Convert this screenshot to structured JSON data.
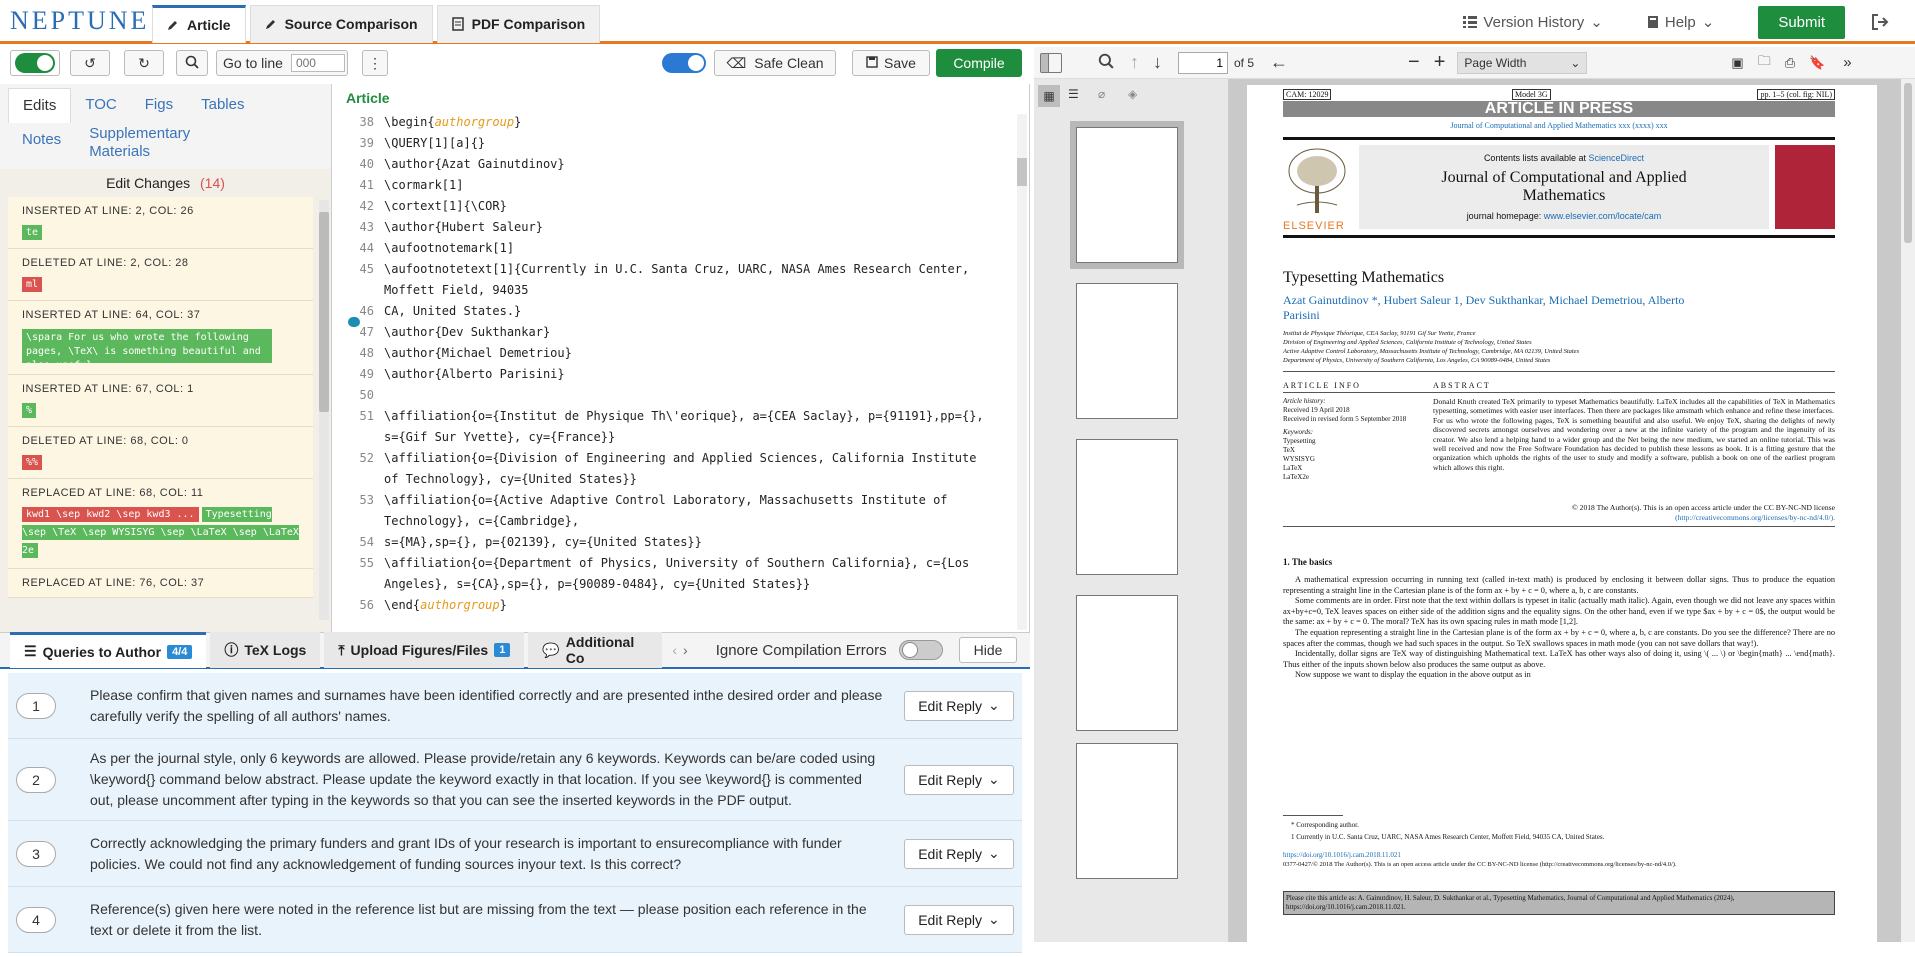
{
  "app": {
    "logo": "NEPTUNE",
    "tabs": [
      "Article",
      "Source Comparison",
      "PDF Comparison"
    ],
    "version_history": "Version History",
    "help": "Help",
    "submit": "Submit"
  },
  "toolbar": {
    "go_to_line": "Go to line",
    "line_placeholder": "000",
    "safe_clean": "Safe Clean",
    "save": "Save",
    "compile": "Compile"
  },
  "left": {
    "tabs": [
      "Edits",
      "TOC",
      "Figs",
      "Tables",
      "Notes",
      "Supplementary Materials"
    ],
    "edit_changes": "Edit Changes",
    "count": "(14)",
    "changes": [
      {
        "label": "INSERTED   AT LINE: 2, COL: 26",
        "type": "ins",
        "text": "te"
      },
      {
        "label": "DELETED   AT LINE: 2, COL: 28",
        "type": "del",
        "text": "ml"
      },
      {
        "label": "INSERTED   AT LINE: 64, COL: 37",
        "type": "ins",
        "text": "\\spara For us who wrote the following pages, \\TeX\\ is something beautiful and also useful."
      },
      {
        "label": "INSERTED   AT LINE: 67, COL: 1",
        "type": "ins",
        "text": "%"
      },
      {
        "label": "DELETED   AT LINE: 68, COL: 0",
        "type": "del",
        "text": "%%"
      },
      {
        "label": "REPLACED   AT LINE: 68, COL: 11",
        "type": "rep",
        "old": "kwd1 \\sep kwd2 \\sep kwd3 ...",
        "text": "Typesetting \\sep \\TeX \\sep WYSISYG \\sep \\LaTeX \\sep \\LaTeX 2e"
      },
      {
        "label": "REPLACED   AT LINE: 76, COL: 37",
        "type": "none",
        "text": ""
      }
    ]
  },
  "editor": {
    "title": "Article",
    "lines": [
      {
        "n": "38",
        "pre": "\\begin{",
        "kw": "authorgroup",
        "post": "}"
      },
      {
        "n": "39",
        "pre": "\\QUERY[1][a]{}"
      },
      {
        "n": "40",
        "pre": "\\author{Azat Gainutdinov}"
      },
      {
        "n": "41",
        "pre": "\\cormark[1]"
      },
      {
        "n": "42",
        "pre": "\\cortext[1]{\\COR}"
      },
      {
        "n": "43",
        "pre": "\\author{Hubert Saleur}"
      },
      {
        "n": "44",
        "pre": "\\aufootnotemark[1]"
      },
      {
        "n": "45",
        "pre": "\\aufootnotetext[1]{Currently in U.C. Santa Cruz, UARC, NASA Ames Research Center, Moffett Field, 94035"
      },
      {
        "n": "46",
        "pre": "CA, United States.}"
      },
      {
        "n": "47",
        "pre": "\\author{Dev Sukthankar}"
      },
      {
        "n": "48",
        "pre": "\\author{Michael Demetriou}"
      },
      {
        "n": "49",
        "pre": "\\author{Alberto Parisini}"
      },
      {
        "n": "50",
        "pre": ""
      },
      {
        "n": "51",
        "pre": "\\affiliation{o={Institut de Physique Th\\'eorique}, a={CEA Saclay}, p={91191},pp={}, s={Gif Sur Yvette}, cy={France}}"
      },
      {
        "n": "52",
        "pre": "\\affiliation{o={Division of Engineering and Applied Sciences, California Institute of Technology}, cy={United States}}"
      },
      {
        "n": "53",
        "pre": "\\affiliation{o={Active Adaptive Control Laboratory, Massachusetts Institute of Technology}, c={Cambridge},"
      },
      {
        "n": "54",
        "pre": "s={MA},sp={}, p={02139}, cy={United States}}"
      },
      {
        "n": "55",
        "pre": "\\affiliation{o={Department of Physics, University of Southern California}, c={Los Angeles}, s={CA},sp={}, p={90089-0484}, cy={United States}}"
      },
      {
        "n": "56",
        "pre": "\\end{",
        "kw": "authorgroup",
        "post": "}"
      }
    ]
  },
  "bottom": {
    "tabs": [
      "Queries to Author",
      "TeX Logs",
      "Upload Figures/Files",
      "Additional Co"
    ],
    "query_badge": "4/4",
    "upload_badge": "1",
    "ignore": "Ignore Compilation Errors",
    "hide": "Hide",
    "edit_reply": "Edit Reply",
    "queries": [
      {
        "n": "1",
        "text": "Please confirm that given names and surnames have been identified correctly and are presented inthe desired order and please carefully verify the spelling of all authors' names."
      },
      {
        "n": "2",
        "text": "As per the journal style, only 6 keywords are allowed. Please provide/retain any 6 keywords. Keywords can be/are coded using \\keyword{} command below abstract. Please update the keyword exactly in that location. If you see \\keyword{} is commented out, please uncomment after typing in the keywords so that you can see the inserted keywords in the PDF output."
      },
      {
        "n": "3",
        "text": "Correctly acknowledging the primary funders and grant IDs of your research is important to ensurecompliance with funder policies. We could not find any acknowledgement of funding sources inyour text. Is this correct?"
      },
      {
        "n": "4",
        "text": "Reference(s) given here were noted in the reference list but are missing from the text — please position each reference in the text or delete it from the list."
      }
    ]
  },
  "pdf": {
    "page": "1",
    "of": "of 5",
    "zoom": "Page Width",
    "cam": "CAM: 12029",
    "model": "Model 3G",
    "pp": "pp. 1–5 (col. fig: NIL)",
    "aip": "ARTICLE IN PRESS",
    "journal_sub": "Journal of Computational and Applied Mathematics xxx (xxxx) xxx",
    "contents": "Contents lists available at",
    "sciencedirect": "ScienceDirect",
    "journal": "Journal of Computational and Applied Mathematics",
    "homepage": "journal homepage:",
    "homepage_url": "www.elsevier.com/locate/cam",
    "elsevier": "ELSEVIER",
    "title": "Typesetting Mathematics",
    "authors": "Azat Gainutdinov *, Hubert Saleur 1, Dev Sukthankar, Michael Demetriou, Alberto Parisini",
    "affils": [
      "Institut de Physique Théorique, CEA Saclay, 91191 Gif Sur Yvette, France",
      "Division of Engineering and Applied Sciences, California Institute of Technology, United States",
      "Active Adaptive Control Laboratory, Massachusetts Institute of Technology, Cambridge, MA 02139, United States",
      "Department of Physics, University of Southern California, Los Angeles, CA 90089-0484, United States"
    ],
    "info_head": "ARTICLE INFO",
    "history": "Article history:",
    "received": "Received 19 April 2018",
    "revised": "Received in revised form 5 September 2018",
    "keywords_head": "Keywords:",
    "keywords": [
      "Typesetting",
      "TeX",
      "WYSISYG",
      "LaTeX",
      "LaTeX2e"
    ],
    "abstract_head": "ABSTRACT",
    "abstract": "Donald Knuth created TeX primarily to typeset Mathematics beautifully. LaTeX includes all the capabilities of TeX in Mathematics typesetting, sometimes with easier user interfaces. Then there are packages like amsmath which enhance and refine these interfaces.\n   For us who wrote the following pages, TeX is something beautiful and also useful. We enjoy TeX, sharing the delights of newly discovered secrets amongst ourselves and wondering over a new at the infinite variety of the program and the ingenuity of its creator. We also lend a helping hand to a wider group and the Net being the new medium, we started an online tutorial. This was well received and now the Free Software Foundation has decided to publish these lessons as book. It is a fitting gesture that the organization which upholds the rights of the user to study and modify a software, publish a book on one of the earliest program which allows this right.",
    "copyright": "© 2018 The Author(s). This is an open access article under the CC BY-NC-ND license",
    "license": "(http://creativecommons.org/licenses/by-nc-nd/4.0/).",
    "section": "1. The basics",
    "body": [
      "A mathematical expression occurring in running text (called in-text math) is produced by enclosing it between dollar signs. Thus to produce the equation representing a straight line in the Cartesian plane is of the form ax + by + c = 0, where a, b, c are constants.",
      "Some comments are in order. First note that the text within dollars is typeset in italic (actually math italic). Again, even though we did not leave any spaces within ax+by+c=0, TeX leaves spaces on either side of the addition signs and the equality signs. On the other hand, even if we type $ax + by + c = 0$, the output would be the same: ax + by + c = 0. The moral? TeX has its own spacing rules in math mode [1,2].",
      "The equation representing a straight line in the Cartesian plane is of the form ax + by + c = 0, where a, b, c are constants. Do you see the difference? There are no spaces after the commas, though we had such spaces in the output. So TeX swallows spaces in math mode (you can not save dollars that way!).",
      "Incidentally, dollar signs are TeX way of distinguishing Mathematical text. LaTeX has other ways also of doing it, using \\( ... \\) or \\begin{math} ... \\end{math}. Thus either of the inputs shown below also produces the same output as above.",
      "Now suppose we want to display the equation in the above output as in"
    ],
    "fn1": "Corresponding author.",
    "fn2": "Currently in U.C. Santa Cruz, UARC, NASA Ames Research Center, Moffett Field, 94035 CA, United States.",
    "doi": "https://doi.org/10.1016/j.cam.2018.11.021",
    "issn": "0377-0427/© 2018 The Author(s). This is an open access article under the CC BY-NC-ND license (http://creativecommons.org/licenses/by-nc-nd/4.0/).",
    "cite": "Please cite this article as: A. Gainutdinov, H. Saleur, D. Sukthankar et al., Typesetting Mathematics, Journal of Computational and Applied Mathematics (2024), https://doi.org/10.1016/j.cam.2018.11.021."
  },
  "colors": {
    "accent": "#2a6db5",
    "brand_orange": "#e87722",
    "green": "#1e8e3e"
  }
}
